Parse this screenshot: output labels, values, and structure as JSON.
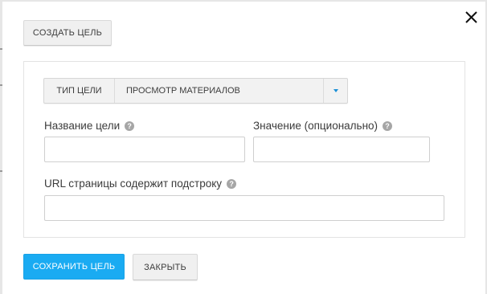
{
  "dialog": {
    "create_goal_button": "СОЗДАТЬ ЦЕЛЬ",
    "goal_type": {
      "label": "ТИП ЦЕЛИ",
      "selected_value": "ПРОСМОТР МАТЕРИАЛОВ"
    },
    "fields": {
      "goal_name": {
        "label": "Название цели",
        "value": ""
      },
      "goal_value": {
        "label": "Значение (опционально)",
        "value": ""
      },
      "url_contains": {
        "label": "URL страницы содержит подстроку",
        "value": ""
      }
    },
    "help_glyph": "?",
    "footer": {
      "save_button": "СОХРАНИТЬ ЦЕЛЬ",
      "close_button": "ЗАКРЫТЬ"
    }
  },
  "icons": {
    "close": "close-icon",
    "help": "help-icon",
    "dropdown": "chevron-down-icon"
  },
  "colors": {
    "accent": "#1aabf2",
    "caret": "#1a8fd6",
    "help_icon": "#a6a6a6"
  }
}
